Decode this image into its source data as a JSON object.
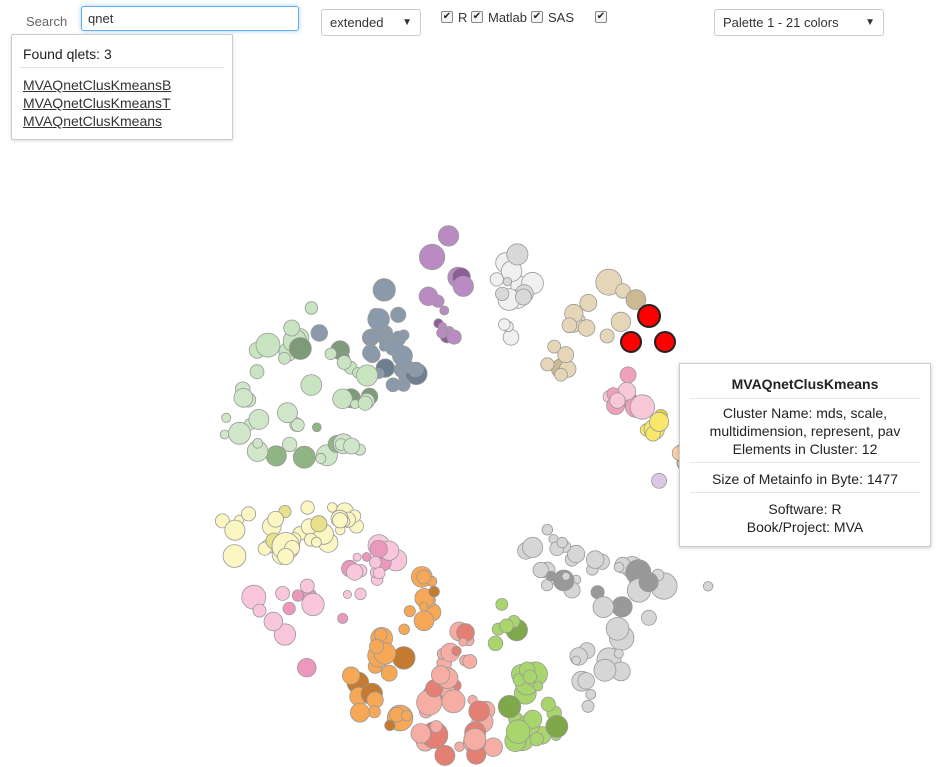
{
  "search": {
    "label": "Search",
    "value": "qnet"
  },
  "mode_select": {
    "value": "extended"
  },
  "filters": [
    {
      "label": "R",
      "checked": true
    },
    {
      "label": "Matlab",
      "checked": true
    },
    {
      "label": "SAS",
      "checked": true
    },
    {
      "label": "",
      "checked": true
    }
  ],
  "palette_select": {
    "value": "Palette 1 - 21 colors"
  },
  "results": {
    "count_text": "Found qlets: 3",
    "items": [
      "MVAQnetClusKmeansB",
      "MVAQnetClusKmeansT",
      "MVAQnetClusKmeans"
    ]
  },
  "tooltip": {
    "title": "MVAQnetClusKmeans",
    "cluster_name_1": "Cluster Name: mds, scale,",
    "cluster_name_2": "multidimension, represent, pav",
    "elements": "Elements in Cluster: 12",
    "size": "Size of Metainfo in Byte: 1477",
    "software": "Software: R",
    "book": "Book/Project: MVA"
  },
  "clusters": [
    {
      "color": "#8a9aab",
      "accent": "#6e7f91"
    },
    {
      "color": "#b98bc2",
      "accent": "#8e5c99"
    },
    {
      "color": "#f0f0f0",
      "accent": "#d8d8d8"
    },
    {
      "color": "#e6d6b8",
      "accent": "#cdb894"
    },
    {
      "color": "#f9c8d8",
      "accent": "#f0a0bc"
    },
    {
      "color": "#f7e76a",
      "accent": "#e8cf30"
    },
    {
      "color": "#f9cfa6",
      "accent": "#efb07a"
    },
    {
      "color": "#dcc8e4",
      "accent": "#b99cc7"
    },
    {
      "color": "#d6d6d6",
      "accent": "#999999"
    },
    {
      "color": "#a9d66c",
      "accent": "#7fa84a"
    },
    {
      "color": "#f5ada4",
      "accent": "#e47f73"
    },
    {
      "color": "#f6a856",
      "accent": "#c47a2f"
    },
    {
      "color": "#f9c6dc",
      "accent": "#ec98bd"
    },
    {
      "color": "#fbf6c2",
      "accent": "#e8e08a"
    },
    {
      "color": "#cfe6c8",
      "accent": "#8fb584"
    },
    {
      "color": "#c8e4c0",
      "accent": "#7d9b78"
    }
  ],
  "highlight_color": "#ff0000"
}
